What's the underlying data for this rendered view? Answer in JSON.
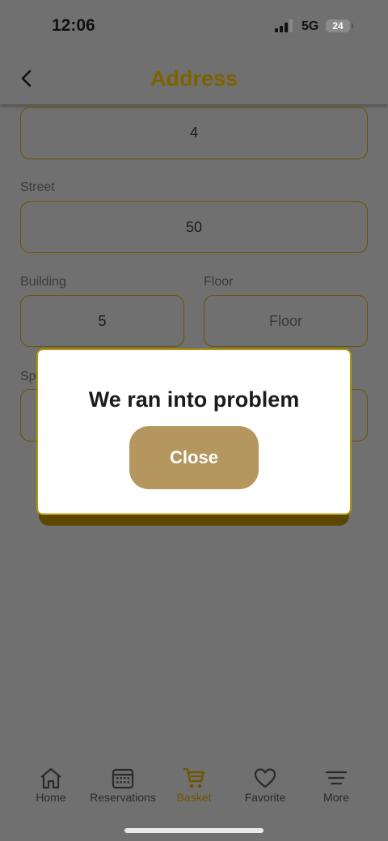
{
  "status_bar": {
    "time": "12:06",
    "network": "5G",
    "battery": "24"
  },
  "header": {
    "title": "Address"
  },
  "form": {
    "first_value": "4",
    "street_label": "Street",
    "street_value": "50",
    "building_label": "Building",
    "building_value": "5",
    "floor_label": "Floor",
    "floor_placeholder": "Floor",
    "special_label_partial": "Sp"
  },
  "dialog": {
    "message": "We ran into problem",
    "close_label": "Close"
  },
  "tabs": [
    {
      "label": "Home",
      "icon": "home-icon"
    },
    {
      "label": "Reservations",
      "icon": "calendar-icon"
    },
    {
      "label": "Basket",
      "icon": "cart-icon"
    },
    {
      "label": "Favorite",
      "icon": "heart-icon"
    },
    {
      "label": "More",
      "icon": "menu-icon"
    }
  ],
  "colors": {
    "accent": "#7c6300",
    "button": "#b4965e",
    "overlay": "#707070"
  }
}
